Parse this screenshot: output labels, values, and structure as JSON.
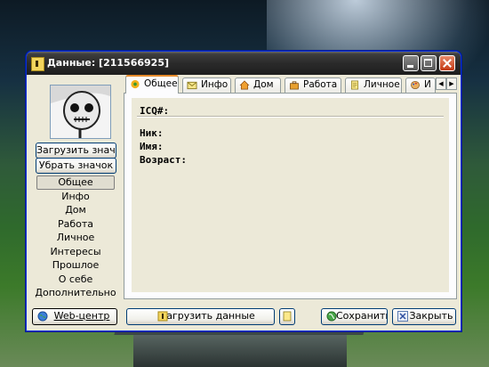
{
  "window": {
    "title": "Данные: [211566925]"
  },
  "tabs": [
    {
      "label": "Общее",
      "icon": "flower-icon",
      "active": true
    },
    {
      "label": "Инфо",
      "icon": "envelope-icon"
    },
    {
      "label": "Дом",
      "icon": "house-icon"
    },
    {
      "label": "Работа",
      "icon": "briefcase-icon"
    },
    {
      "label": "Личное",
      "icon": "document-icon"
    },
    {
      "label": "И",
      "icon": "palette-icon"
    }
  ],
  "avatar_buttons": {
    "upload": "Загрузить значок",
    "remove": "Убрать значок"
  },
  "sidebar": {
    "items": [
      "Общее",
      "Инфо",
      "Дом",
      "Работа",
      "Личное",
      "Интересы",
      "Прошлое",
      "О себе",
      "Дополнительно"
    ],
    "selected": 0
  },
  "fields": {
    "icq": "ICQ#:",
    "nick": "Ник:",
    "name": "Имя:",
    "age": "Возраст:"
  },
  "footer": {
    "web": "Web-центр",
    "load": "Загрузить данные",
    "save": "Сохранить",
    "close": "Закрыть"
  },
  "colors": {
    "tab_accent": "#e68b2c",
    "titlebar": "#2a2a2a",
    "close_button": "#c43a14"
  }
}
